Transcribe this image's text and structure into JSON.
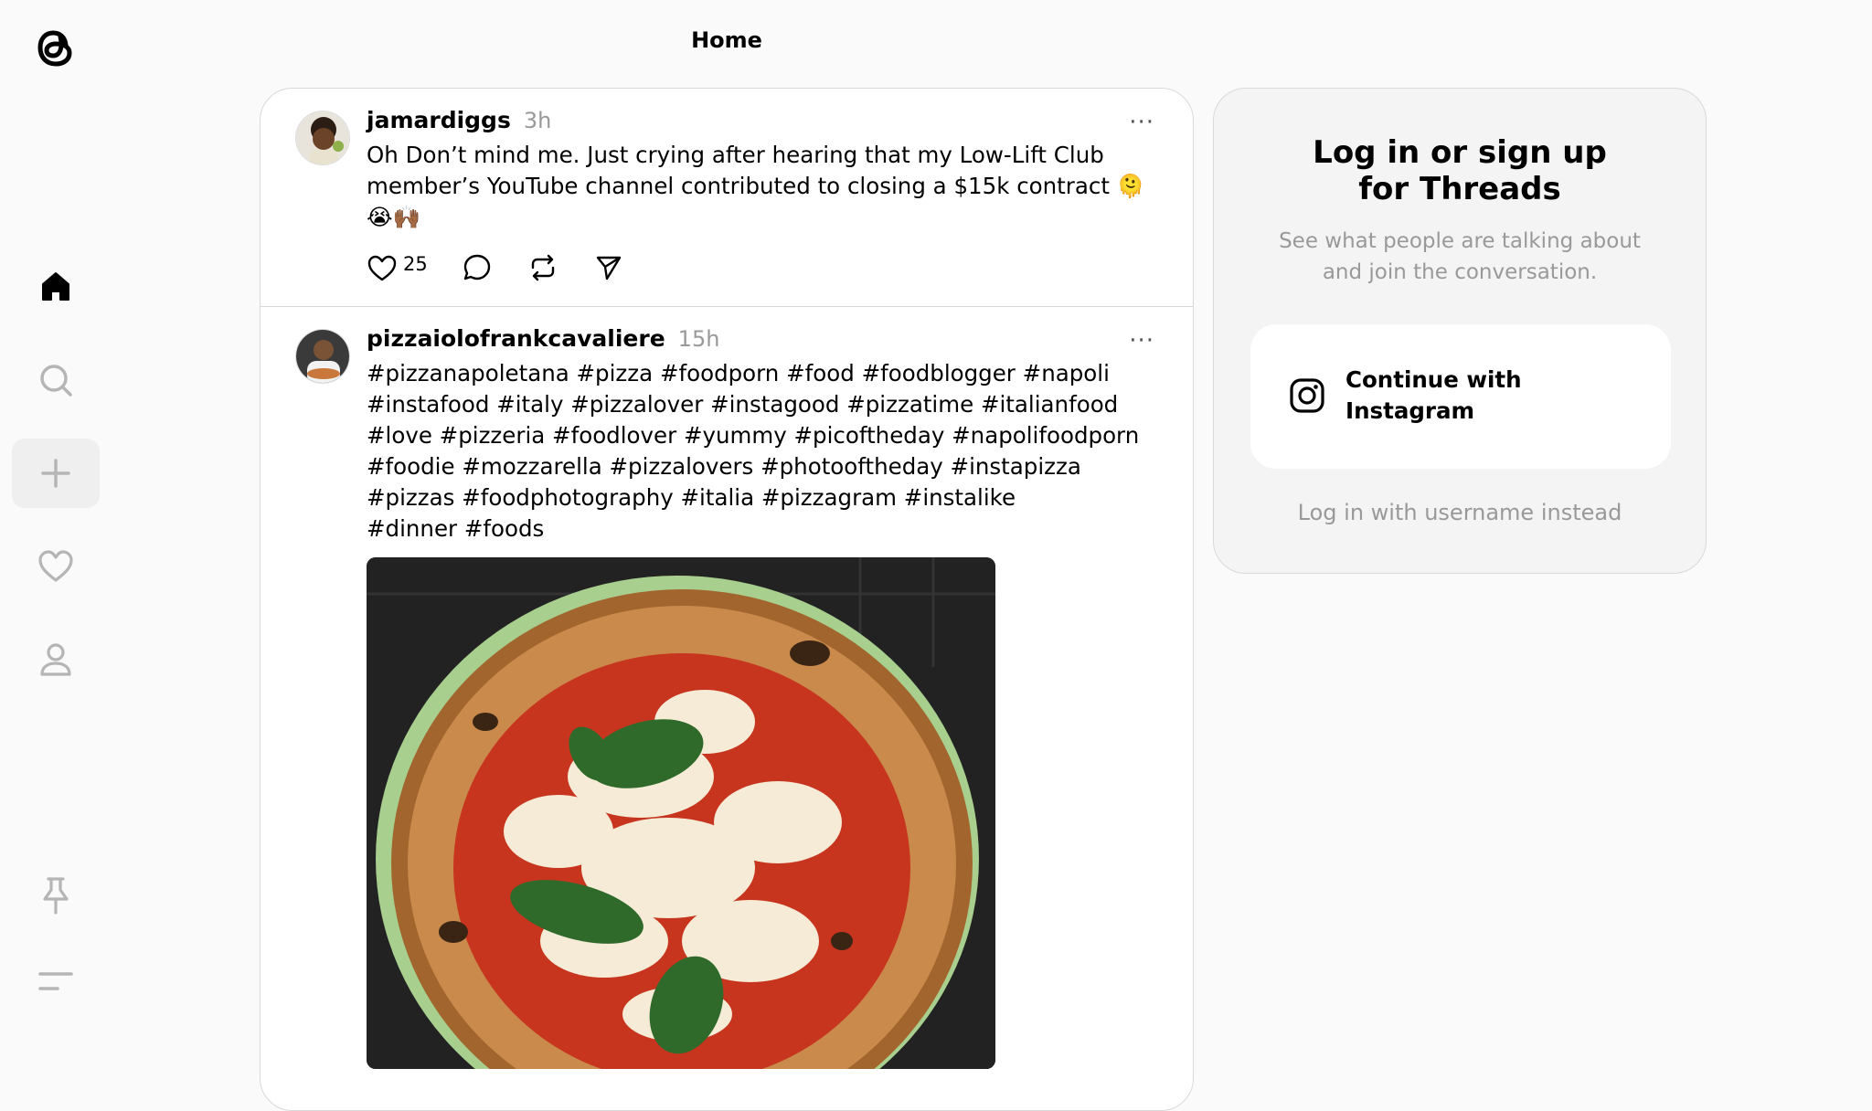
{
  "header": {
    "title": "Home"
  },
  "sidebar": {
    "items": [
      {
        "name": "home",
        "icon": "home-icon"
      },
      {
        "name": "search",
        "icon": "search-icon"
      },
      {
        "name": "create",
        "icon": "plus-icon"
      },
      {
        "name": "activity",
        "icon": "heart-icon"
      },
      {
        "name": "profile",
        "icon": "user-icon"
      },
      {
        "name": "pinned",
        "icon": "pin-icon"
      },
      {
        "name": "menu",
        "icon": "menu-icon"
      }
    ]
  },
  "posts": [
    {
      "username": "jamardiggs",
      "time": "3h",
      "text": "Oh Don’t mind me. Just crying after hearing that my Low-Lift Club\nmember’s YouTube channel contributed to closing a $15k contract 🫠\n😭🙌🏾",
      "likes": "25",
      "more": "···"
    },
    {
      "username": "pizzaiolofrankcavaliere",
      "time": "15h",
      "text": "#pizzanapoletana #pizza #foodporn #food #foodblogger #napoli\n#instafood #italy #pizzalover #instagood #pizzatime #italianfood\n#love #pizzeria #foodlover #yummy #picoftheday #napolifoodporn\n#foodie #mozzarella #pizzalovers #photooftheday #instapizza\n#pizzas #foodphotography #italia #pizzagram #instalike\n#dinner #foods",
      "more": "···"
    }
  ],
  "login": {
    "title": "Log in or sign up for Threads",
    "subtitle": "See what people are talking about and join the conversation.",
    "instagram_button": "Continue with Instagram",
    "username_link": "Log in with username instead"
  }
}
